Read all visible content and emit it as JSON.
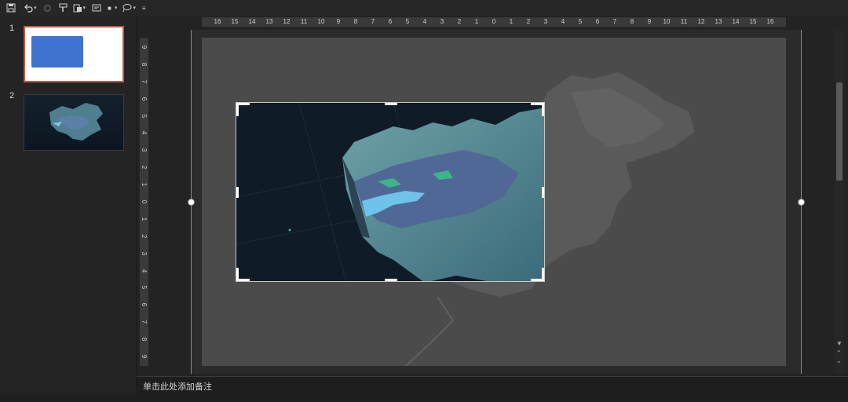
{
  "toolbar": {
    "icons": [
      "save-icon",
      "undo-icon",
      "redo-icon",
      "format-painter-icon",
      "paste-icon",
      "textbox-icon",
      "shape-icon",
      "lasso-icon",
      "more-icon"
    ]
  },
  "slides": [
    {
      "number": "1"
    },
    {
      "number": "2"
    }
  ],
  "ruler": {
    "horizontal": [
      "16",
      "15",
      "14",
      "13",
      "12",
      "11",
      "10",
      "9",
      "8",
      "7",
      "6",
      "5",
      "4",
      "3",
      "2",
      "1",
      "0",
      "1",
      "2",
      "3",
      "4",
      "5",
      "6",
      "7",
      "8",
      "9",
      "10",
      "11",
      "12",
      "13",
      "14",
      "15",
      "16"
    ],
    "vertical": [
      "9",
      "8",
      "7",
      "6",
      "5",
      "4",
      "3",
      "2",
      "1",
      "0",
      "1",
      "2",
      "3",
      "4",
      "5",
      "6",
      "7",
      "8",
      "9"
    ]
  },
  "notes": {
    "placeholder": "单击此处添加备注"
  },
  "colors": {
    "accent_selected": "#c8553d",
    "slide_bg": "#4b4b4b",
    "thumb_shape": "#3f73cf"
  }
}
